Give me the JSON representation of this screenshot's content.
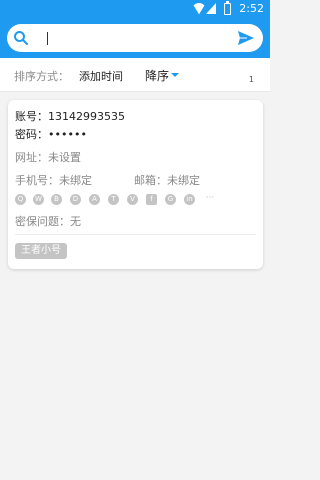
{
  "status": {
    "time": "2:52"
  },
  "search": {
    "placeholder": ""
  },
  "sort": {
    "label": "排序方式：",
    "field": "添加时间",
    "order": "降序",
    "count": "1"
  },
  "accounts": [
    {
      "account": "账号：13142993535",
      "password": "密码：••••••",
      "url": "网址：未设置",
      "phone": "手机号：未绑定",
      "email": "邮箱：未绑定",
      "security": "密保问题：无",
      "tag": "王者小号",
      "bound_icons": [
        "qq-icon",
        "wechat-icon",
        "weibo-icon",
        "baidu-icon",
        "alipay-icon",
        "taobao-icon",
        "ding-icon",
        "facebook-icon",
        "github-icon",
        "linkedin-icon",
        "more-icon"
      ]
    }
  ],
  "colors": {
    "primary": "#1e9bf0",
    "muted_icon": "#c4c4c4"
  }
}
